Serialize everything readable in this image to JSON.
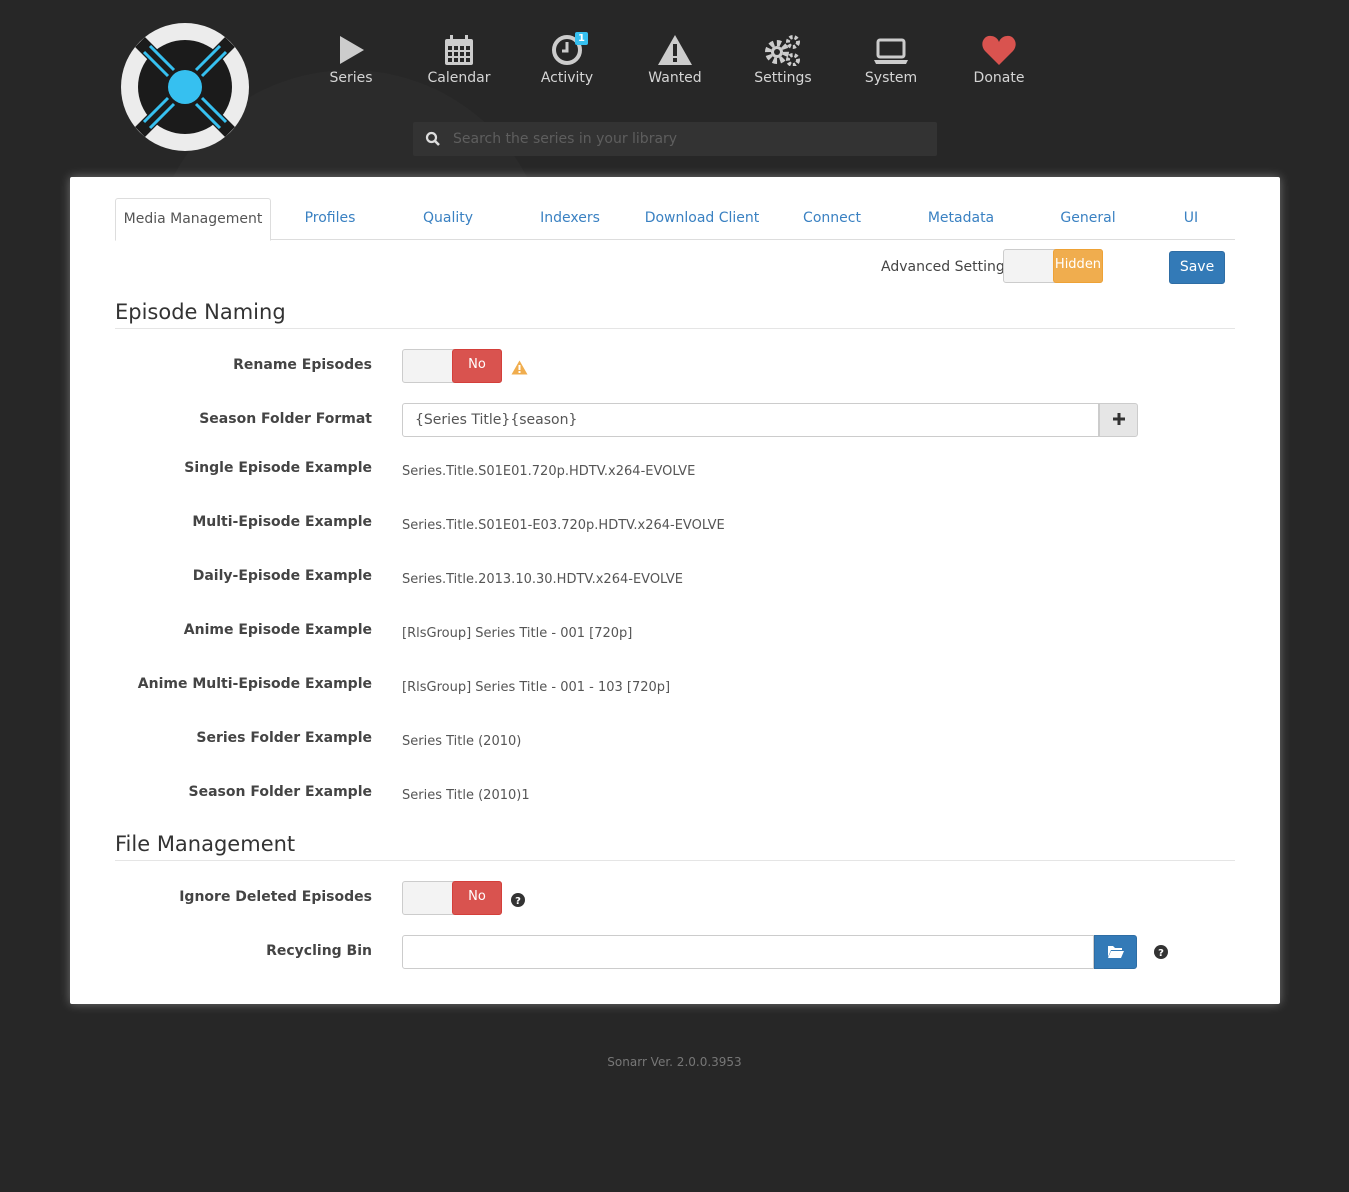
{
  "nav": {
    "items": [
      {
        "label": "Series",
        "icon": "play-icon"
      },
      {
        "label": "Calendar",
        "icon": "calendar-icon"
      },
      {
        "label": "Activity",
        "icon": "clock-icon",
        "badge": "1"
      },
      {
        "label": "Wanted",
        "icon": "warning-icon"
      },
      {
        "label": "Settings",
        "icon": "cogs-icon"
      },
      {
        "label": "System",
        "icon": "laptop-icon"
      },
      {
        "label": "Donate",
        "icon": "heart-icon",
        "color": "#d9534f"
      }
    ]
  },
  "search": {
    "placeholder": "Search the series in your library"
  },
  "tabs": [
    "Media Management",
    "Profiles",
    "Quality",
    "Indexers",
    "Download Client",
    "Connect",
    "Metadata",
    "General",
    "UI"
  ],
  "toolbar": {
    "advanced_label": "Advanced Settings",
    "advanced_state": "Hidden",
    "save_label": "Save"
  },
  "episode_naming": {
    "heading": "Episode Naming",
    "rename_label": "Rename Episodes",
    "rename_state": "No",
    "season_folder_label": "Season Folder Format",
    "season_folder_value": "{Series Title}{season}",
    "examples": [
      {
        "label": "Single Episode Example",
        "value": "Series.Title.S01E01.720p.HDTV.x264-EVOLVE"
      },
      {
        "label": "Multi-Episode Example",
        "value": "Series.Title.S01E01-E03.720p.HDTV.x264-EVOLVE"
      },
      {
        "label": "Daily-Episode Example",
        "value": "Series.Title.2013.10.30.HDTV.x264-EVOLVE"
      },
      {
        "label": "Anime Episode Example",
        "value": "[RlsGroup] Series Title - 001 [720p]"
      },
      {
        "label": "Anime Multi-Episode Example",
        "value": "[RlsGroup] Series Title - 001 - 103 [720p]"
      },
      {
        "label": "Series Folder Example",
        "value": "Series Title (2010)"
      },
      {
        "label": "Season Folder Example",
        "value": "Series Title (2010)1"
      }
    ]
  },
  "file_management": {
    "heading": "File Management",
    "ignore_deleted_label": "Ignore Deleted Episodes",
    "ignore_deleted_state": "No",
    "recycling_bin_label": "Recycling Bin",
    "recycling_bin_value": ""
  },
  "footer": {
    "version": "Sonarr Ver. 2.0.0.3953"
  },
  "colors": {
    "accent": "#36c0f0",
    "primary": "#337ab7",
    "danger": "#d9534f",
    "warning": "#f0ad4e"
  }
}
